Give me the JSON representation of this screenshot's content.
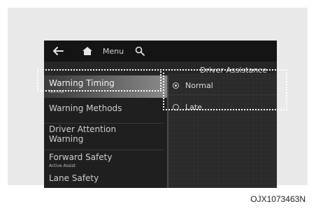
{
  "toolbar": {
    "back_icon": "back-arrow-icon",
    "home_icon": "home-icon",
    "menu_label": "Menu",
    "search_icon": "search-icon"
  },
  "page": {
    "title": "Driver Assistance"
  },
  "menu_items": [
    {
      "label": "Warning Timing",
      "sub": "Normal",
      "selected": true
    },
    {
      "label": "Warning Methods",
      "sub": ""
    },
    {
      "label": "Driver Attention",
      "label2": "Warning",
      "sub": ""
    },
    {
      "label": "Forward Safety",
      "sub": "Active Assist"
    },
    {
      "label": "Lane Safety",
      "sub": ""
    }
  ],
  "options": [
    {
      "label": "Normal",
      "selected": true
    },
    {
      "label": "Late",
      "selected": false
    }
  ],
  "caption": "OJX1073463N"
}
